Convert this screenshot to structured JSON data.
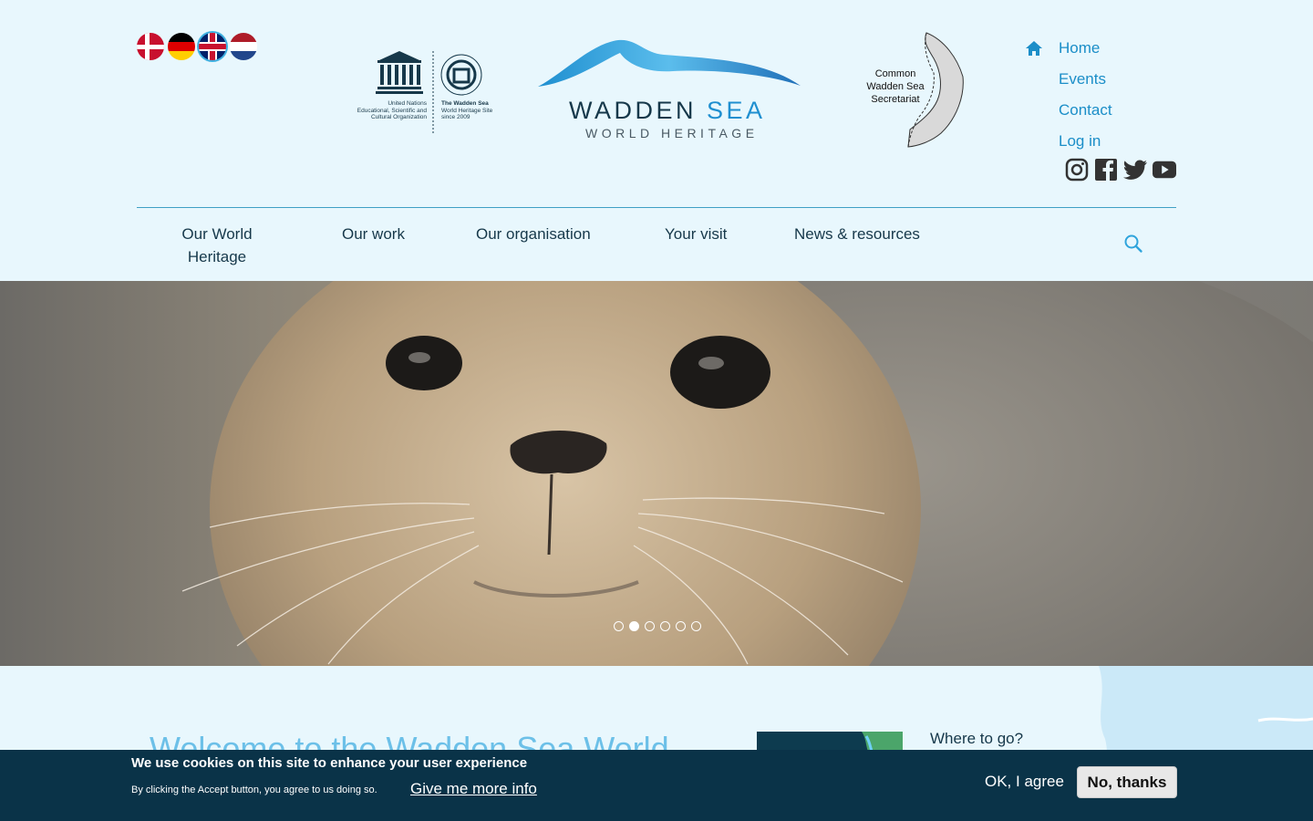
{
  "languages": [
    {
      "code": "da",
      "label": "Danish"
    },
    {
      "code": "de",
      "label": "German"
    },
    {
      "code": "en",
      "label": "English"
    },
    {
      "code": "nl",
      "label": "Dutch"
    }
  ],
  "unesco": {
    "org_text_line1": "United Nations",
    "org_text_line2": "Educational, Scientific and",
    "org_text_line3": "Cultural Organization",
    "site_text_line1": "The Wadden Sea",
    "site_text_line2": "World Heritage Site",
    "site_text_line3": "since 2009"
  },
  "logo": {
    "title_main": "WADDEN ",
    "title_accent": "SEA",
    "subtitle": "WORLD HERITAGE"
  },
  "cwss": {
    "line1": "Common",
    "line2": "Wadden Sea",
    "line3": "Secretariat"
  },
  "top_nav": {
    "home": "Home",
    "events": "Events",
    "contact": "Contact",
    "login": "Log in"
  },
  "social": [
    "instagram-icon",
    "facebook-icon",
    "twitter-icon",
    "youtube-icon"
  ],
  "main_nav": {
    "item1_line1": "Our World",
    "item1_line2": "Heritage",
    "item2": "Our work",
    "item3": "Our organisation",
    "item4": "Your visit",
    "item5": "News & resources"
  },
  "hero": {
    "slides": 6,
    "active_slide": 2
  },
  "content": {
    "welcome": "Welcome to the Wadden Sea World",
    "where_to_go": "Where to go?"
  },
  "cookie": {
    "title": "We use cookies on this site to enhance your user experience",
    "text": "By clicking the Accept button, you agree to us doing so.",
    "more_info": "Give me more info",
    "ok": "OK, I agree",
    "no": "No, thanks"
  },
  "colors": {
    "background": "#e8f7fd",
    "accent": "#1b8ec8",
    "dark": "#0a3348"
  }
}
